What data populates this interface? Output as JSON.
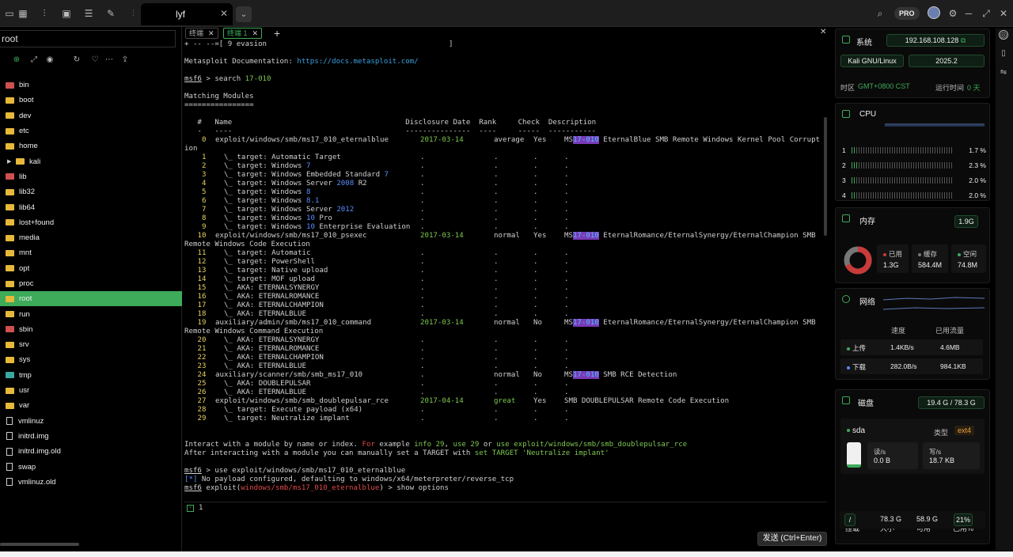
{
  "tabbar": {
    "active_tab": "lyf",
    "close": "✕",
    "dropdown": "⌄",
    "prime_badge": "PRO"
  },
  "sidebar": {
    "path": "root",
    "items": [
      {
        "name": "bin",
        "type": "folder-red"
      },
      {
        "name": "boot",
        "type": "folder"
      },
      {
        "name": "dev",
        "type": "folder"
      },
      {
        "name": "etc",
        "type": "folder"
      },
      {
        "name": "home",
        "type": "folder"
      },
      {
        "name": "kali",
        "type": "folder-child"
      },
      {
        "name": "lib",
        "type": "folder-red"
      },
      {
        "name": "lib32",
        "type": "folder"
      },
      {
        "name": "lib64",
        "type": "folder"
      },
      {
        "name": "lost+found",
        "type": "folder"
      },
      {
        "name": "media",
        "type": "folder"
      },
      {
        "name": "mnt",
        "type": "folder"
      },
      {
        "name": "opt",
        "type": "folder"
      },
      {
        "name": "proc",
        "type": "folder"
      },
      {
        "name": "root",
        "type": "folder-active"
      },
      {
        "name": "run",
        "type": "folder"
      },
      {
        "name": "sbin",
        "type": "folder-red"
      },
      {
        "name": "srv",
        "type": "folder"
      },
      {
        "name": "sys",
        "type": "folder"
      },
      {
        "name": "tmp",
        "type": "folder-teal"
      },
      {
        "name": "usr",
        "type": "folder"
      },
      {
        "name": "var",
        "type": "folder"
      },
      {
        "name": "vmlinuz",
        "type": "file"
      },
      {
        "name": "initrd.img",
        "type": "file"
      },
      {
        "name": "initrd.img.old",
        "type": "file"
      },
      {
        "name": "swap",
        "type": "file"
      },
      {
        "name": "vmlinuz.old",
        "type": "file"
      }
    ]
  },
  "terminal": {
    "tabs": [
      {
        "label": "终端",
        "active": false
      },
      {
        "label": "终端 1",
        "active": true
      }
    ],
    "add": "+",
    "input_value": "1",
    "send_label": "发送 (Ctrl+Enter)",
    "lines": {
      "l0": "+ -- --=[ 9 evasion                                          ]",
      "doc_label": "Metasploit Documentation: ",
      "doc_url": "https://docs.metasploit.com/",
      "prompt": "msf6",
      "search_cmd": " > search ",
      "search_arg": "17-010",
      "matching": "Matching Modules",
      "rule": "================",
      "hdr": "   #   Name                                        Disclosure Date  Rank     Check  Description",
      "hdr_rule": "   -   ----                                        ---------------  ----     -----  -----------",
      "rows": [
        {
          "n": "0",
          "name": "exploit/windows/smb/ms17_010_eternalblue",
          "date": "2017-03-14",
          "rank": "average",
          "check": "Yes",
          "desc_pre": "MS",
          "desc_hl": "17-010",
          "desc_post": " EternalBlue SMB Remote Windows Kernel Pool Corrupt"
        },
        {
          "n": "1",
          "name": "  \\_ target: Automatic Target"
        },
        {
          "n": "2",
          "name": "  \\_ target: Windows ",
          "num": "7"
        },
        {
          "n": "3",
          "name": "  \\_ target: Windows Embedded Standard ",
          "num": "7"
        },
        {
          "n": "4",
          "name": "  \\_ target: Windows Server ",
          "num": "2008",
          "rest": " R2"
        },
        {
          "n": "5",
          "name": "  \\_ target: Windows ",
          "num": "8"
        },
        {
          "n": "6",
          "name": "  \\_ target: Windows ",
          "num": "8.1"
        },
        {
          "n": "7",
          "name": "  \\_ target: Windows Server ",
          "num": "2012"
        },
        {
          "n": "8",
          "name": "  \\_ target: Windows ",
          "num": "10",
          "rest": " Pro"
        },
        {
          "n": "9",
          "name": "  \\_ target: Windows ",
          "num": "10",
          "rest": " Enterprise Evaluation"
        },
        {
          "n": "10",
          "name": "exploit/windows/smb/ms17_010_psexec",
          "date": "2017-03-14",
          "rank": "normal",
          "check": "Yes",
          "desc_pre": "MS",
          "desc_hl": "17-010",
          "desc_post": " EternalRomance/EternalSynergy/EternalChampion SMB"
        },
        {
          "n": "11",
          "name": "  \\_ target: Automatic"
        },
        {
          "n": "12",
          "name": "  \\_ target: PowerShell"
        },
        {
          "n": "13",
          "name": "  \\_ target: Native upload"
        },
        {
          "n": "14",
          "name": "  \\_ target: MOF upload"
        },
        {
          "n": "15",
          "name": "  \\_ AKA: ETERNALSYNERGY"
        },
        {
          "n": "16",
          "name": "  \\_ AKA: ETERNALROMANCE"
        },
        {
          "n": "17",
          "name": "  \\_ AKA: ETERNALCHAMPION"
        },
        {
          "n": "18",
          "name": "  \\_ AKA: ETERNALBLUE"
        },
        {
          "n": "19",
          "name": "auxiliary/admin/smb/ms17_010_command",
          "date": "2017-03-14",
          "rank": "normal",
          "check": "No",
          "desc_pre": "MS",
          "desc_hl": "17-010",
          "desc_post": " EternalRomance/EternalSynergy/EternalChampion SMB"
        },
        {
          "n": "20",
          "name": "  \\_ AKA: ETERNALSYNERGY"
        },
        {
          "n": "21",
          "name": "  \\_ AKA: ETERNALROMANCE"
        },
        {
          "n": "22",
          "name": "  \\_ AKA: ETERNALCHAMPION"
        },
        {
          "n": "23",
          "name": "  \\_ AKA: ETERNALBLUE"
        },
        {
          "n": "24",
          "name": "auxiliary/scanner/smb/smb_ms17_010",
          "date": "",
          "rank": "normal",
          "check": "No",
          "desc_pre": "MS",
          "desc_hl": "17-010",
          "desc_post": " SMB RCE Detection"
        },
        {
          "n": "25",
          "name": "  \\_ AKA: DOUBLEPULSAR"
        },
        {
          "n": "26",
          "name": "  \\_ AKA: ETERNALBLUE"
        },
        {
          "n": "27",
          "name": "exploit/windows/smb/smb_doublepulsar_rce",
          "date": "2017-04-14",
          "rank": "great",
          "check": "Yes",
          "desc_pre": "SMB DOUBLEPULSAR Remote Code Execution",
          "desc_hl": "",
          "desc_post": ""
        },
        {
          "n": "28",
          "name": "  \\_ target: Execute payload (x64)"
        },
        {
          "n": "29",
          "name": "  \\_ target: Neutralize implant"
        }
      ],
      "wrap0": "ion",
      "wrap10": "Remote Windows Code Execution",
      "wrap19": "Remote Windows Command Execution",
      "interact_a": "Interact with a module by name or index. ",
      "interact_for": "For",
      "interact_b": " example ",
      "interact_c": "info 29",
      "interact_d": ", ",
      "interact_e": "use 29",
      "interact_f": " or ",
      "interact_g": "use exploit/windows/smb/smb_doublepulsar_rce",
      "after_a": "After interacting with a module you can manually set a TARGET with ",
      "after_b": "set TARGET 'Neutralize implant'",
      "use_cmd": " > use exploit/windows/smb/ms17_010_eternalblue",
      "info_star": "[*]",
      "info_text": " No payload configured, defaulting to windows/x64/meterpreter/reverse_tcp",
      "exploit_pre": " exploit(",
      "exploit_mod": "windows/smb/ms17_010_eternalblue",
      "exploit_post": ") > show options"
    }
  },
  "system": {
    "title": "系统",
    "ip": "192.168.108.128",
    "os": "Kali GNU/Linux",
    "version": "2025.2",
    "tz_label": "时区",
    "tz_value": "GMT+0800  CST",
    "uptime_label": "运行时间",
    "uptime_value": "0 天"
  },
  "cpu": {
    "title": "CPU",
    "cores": [
      {
        "n": "1",
        "pct": "1.7 %",
        "fill": 0.05
      },
      {
        "n": "2",
        "pct": "2.3 %",
        "fill": 0.06
      },
      {
        "n": "3",
        "pct": "2.0 %",
        "fill": 0.02
      },
      {
        "n": "4",
        "pct": "2.0 %",
        "fill": 0.02
      }
    ]
  },
  "memory": {
    "title": "内存",
    "total": "1.9G",
    "used_label": "已用",
    "used": "1.3G",
    "cache_label": "缓存",
    "cache": "584.4M",
    "free_label": "空闲",
    "free": "74.8M",
    "used_fraction": 0.68
  },
  "network": {
    "title": "网络",
    "speed_h": "速度",
    "traffic_h": "已用流量",
    "up_label": "上传",
    "up_speed": "1.4KB/s",
    "up_total": "4.6MB",
    "down_label": "下载",
    "down_speed": "282.0B/s",
    "down_total": "984.1KB"
  },
  "disk": {
    "title": "磁盘",
    "usage": "19.4 G / 78.3 G",
    "device": "sda",
    "type_label": "类型",
    "type": "ext4",
    "read_label": "读/s",
    "read": "0.0 B",
    "write_label": "写/s",
    "write": "18.7 KB",
    "cols": [
      "挂载",
      "大小",
      "可用",
      "已用%"
    ],
    "mount": "/",
    "size": "78.3 G",
    "avail": "58.9 G",
    "used_pct": "21%"
  },
  "colors": {
    "accent": "#3dab5a",
    "highlight": "#7a3ab8",
    "link": "#3aa0e0"
  }
}
